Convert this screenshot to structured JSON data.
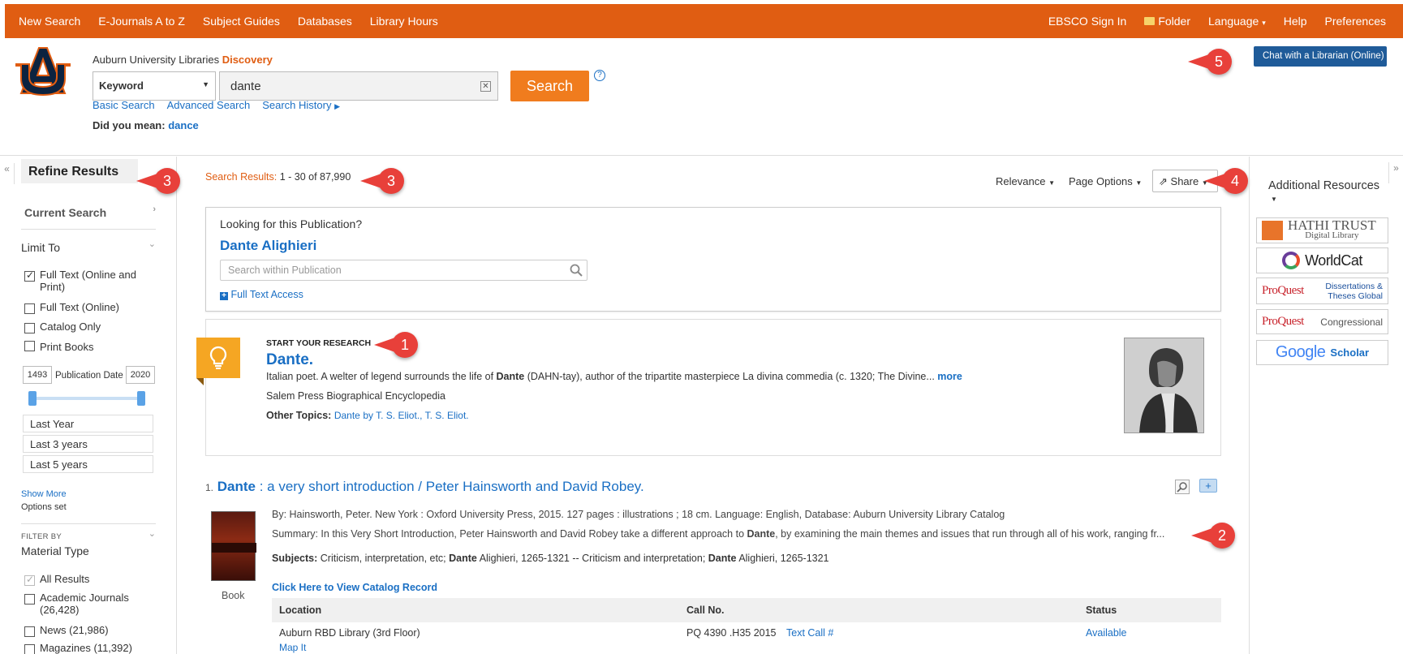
{
  "topnav": {
    "left": [
      "New Search",
      "E-Journals A to Z",
      "Subject Guides",
      "Databases",
      "Library Hours"
    ],
    "right": {
      "signin": "EBSCO Sign In",
      "folder": "Folder",
      "language": "Language",
      "help": "Help",
      "preferences": "Preferences"
    }
  },
  "header": {
    "brand": "Auburn University Libraries",
    "brand_accent": "Discovery",
    "field": "Keyword",
    "query": "dante",
    "search_btn": "Search",
    "help": "?",
    "links": [
      "Basic Search",
      "Advanced Search",
      "Search History"
    ],
    "didyoumean_label": "Did you mean:",
    "didyoumean_value": "dance",
    "chat": "Chat with a Librarian (Online)"
  },
  "badges": {
    "b1": "1",
    "b2": "2",
    "b3": "3",
    "b4": "4",
    "b5": "5"
  },
  "sidebar": {
    "collapse": "«",
    "title": "Refine Results",
    "current": "Current Search",
    "limit": "Limit To",
    "limits": [
      "Full Text (Online and Print)",
      "Full Text (Online)",
      "Catalog Only",
      "Print Books"
    ],
    "date_from": "1493",
    "date_label": "Publication Date",
    "date_to": "2020",
    "years": [
      "Last Year",
      "Last 3 years",
      "Last 5 years"
    ],
    "show_more": "Show More",
    "options_set": "Options set",
    "filter_by": "Filter By",
    "material": "Material Type",
    "types": [
      "All Results",
      "Academic Journals (26,428)",
      "News (21,986)",
      "Magazines (11,392)"
    ]
  },
  "results": {
    "label": "Search Results:",
    "range": "1 - 30 of 87,990",
    "sort": "Relevance",
    "page_options": "Page Options",
    "share": "Share"
  },
  "publication": {
    "heading": "Looking for this Publication?",
    "title": "Dante Alighieri",
    "placeholder": "Search within Publication",
    "fulltext": "Full Text Access"
  },
  "research": {
    "kicker": "START YOUR RESEARCH",
    "title": "Dante.",
    "desc_a": "Italian poet. A welter of legend surrounds the life of ",
    "desc_b": "Dante",
    "desc_c": " (DAHN-tay), author of the tripartite masterpiece La divina commedia (c. 1320; The Divine...",
    "more": "more",
    "source": "Salem Press Biographical Encyclopedia",
    "other_label": "Other Topics:",
    "other_1": "Dante",
    "other_2": "by T. S. Eliot.",
    "other_3": ", T. S. Eliot."
  },
  "result1": {
    "num": "1.",
    "title_a": "Dante",
    "title_b": " : a very short introduction / Peter Hainsworth and David Robey.",
    "meta": "By: Hainsworth, Peter. New York : Oxford University Press, 2015. 127 pages : illustrations ; 18 cm. Language: English, Database: Auburn University Library Catalog",
    "summary_a": "Summary: In this Very Short Introduction, Peter Hainsworth and David Robey take a different approach to ",
    "summary_b": "Dante",
    "summary_c": ", by examining the main themes and issues that run through all of his work, ranging fr...",
    "subjects_label": "Subjects:",
    "subj_1": "Criticism, interpretation, etc;",
    "subj_2": "Dante",
    "subj_3": "Alighieri, 1265-1321 -- Criticism and interpretation;",
    "subj_4": "Dante",
    "subj_5": "Alighieri, 1265-1321",
    "format": "Book",
    "catalog_link": "Click Here to View Catalog Record",
    "cols": [
      "Location",
      "Call No.",
      "Status"
    ],
    "location": "Auburn RBD Library (3rd Floor)",
    "mapit": "Map It",
    "callno": "PQ 4390 .H35 2015",
    "textcall": "Text Call #",
    "status": "Available"
  },
  "right": {
    "expand": "»",
    "title": "Additional Resources",
    "r1a": "HATHI TRUST",
    "r1b": "Digital Library",
    "r2": "WorldCat",
    "r3a": "ProQuest",
    "r3b": "Dissertations &",
    "r3c": "Theses Global",
    "r4a": "ProQuest",
    "r4b": "Congressional",
    "r5a": "Google",
    "r5b": "Scholar"
  },
  "colors": {
    "orange": "#e05d12",
    "blue": "#1a6fc4",
    "badge": "#e8403a"
  }
}
